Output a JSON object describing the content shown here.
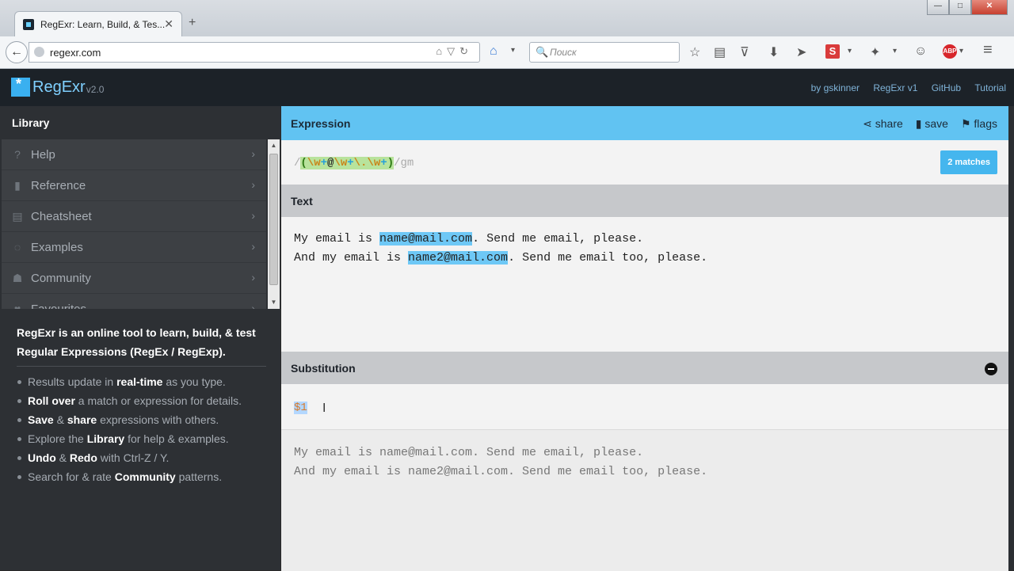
{
  "browser": {
    "tab_title": "RegExr: Learn, Build, & Tes...",
    "tab_close": "✕",
    "new_tab": "+",
    "window_buttons": [
      "—",
      "□",
      "✕"
    ],
    "back_glyph": "←",
    "url": "regexr.com",
    "url_icons": "⌂▽↻",
    "search_placeholder": "Поиск",
    "search_glyph": "🔍",
    "home_glyph": "⌂",
    "dropdown_glyph": "▾",
    "toolbar_icons": {
      "bookmark_star": "☆",
      "reading_list": "▤",
      "pocket": "⊽",
      "download": "⬇",
      "send": "➤",
      "s_addon": "S",
      "addon2": "✦",
      "chat": "☺",
      "adblock": "ABP",
      "menu": "≡"
    }
  },
  "app": {
    "name": "RegExr",
    "version": "v2.0",
    "top_links": [
      "by gskinner",
      "RegExr v1",
      "GitHub",
      "Tutorial"
    ]
  },
  "sidebar": {
    "title": "Library",
    "items": [
      {
        "label": "Help",
        "icon": "?"
      },
      {
        "label": "Reference",
        "icon": "▮"
      },
      {
        "label": "Cheatsheet",
        "icon": "▤"
      },
      {
        "label": "Examples",
        "icon": "◌"
      },
      {
        "label": "Community",
        "icon": "☗"
      },
      {
        "label": "Favourites",
        "icon": "♥"
      }
    ],
    "arrow": "›",
    "intro": "RegExr is an online tool to learn, build, & test Regular Expressions (RegEx / RegExp).",
    "features": [
      {
        "pre": "Results update in ",
        "bold": "real-time",
        "post": " as you type.",
        "bold2": "",
        "post2": ""
      },
      {
        "pre": "",
        "bold": "Roll over",
        "post": " a match or expression for details.",
        "bold2": "",
        "post2": ""
      },
      {
        "pre": "",
        "bold": "Save",
        "post": " & ",
        "bold2": "share",
        "post2": " expressions with others."
      },
      {
        "pre": "Explore the ",
        "bold": "Library",
        "post": " for help & examples.",
        "bold2": "",
        "post2": ""
      },
      {
        "pre": "",
        "bold": "Undo",
        "post": " & ",
        "bold2": "Redo",
        "post2": " with Ctrl-Z / Y."
      },
      {
        "pre": "Search for & rate ",
        "bold": "Community",
        "post": " patterns.",
        "bold2": "",
        "post2": ""
      }
    ]
  },
  "expression": {
    "title": "Expression",
    "actions": {
      "share": "share",
      "save": "save",
      "flags": "flags"
    },
    "action_icons": {
      "share": "⋖",
      "save": "▮",
      "flags": "⚑"
    },
    "regex": {
      "open": "/",
      "group_open": "(",
      "part1": "\\w",
      "q1": "+",
      "at": "@",
      "part2": "\\w",
      "q2": "+",
      "dot": "\\.",
      "part3": "\\w",
      "q3": "+",
      "group_close": ")",
      "close": "/",
      "flags": "gm"
    },
    "matches_badge": "2 matches"
  },
  "text": {
    "title": "Text",
    "line1_pre": "My email is ",
    "line1_match": "name@mail.com",
    "line1_post": ". Send me email, please.",
    "line2_pre": "And my email is ",
    "line2_match": "name2@mail.com",
    "line2_post": ". Send me email too, please."
  },
  "substitution": {
    "title": "Substitution",
    "value": "$1",
    "cursor_glyph": "I",
    "result_line1": "My email is name@mail.com. Send me email, please.",
    "result_line2": "And my email is name2@mail.com. Send me email too, please."
  }
}
